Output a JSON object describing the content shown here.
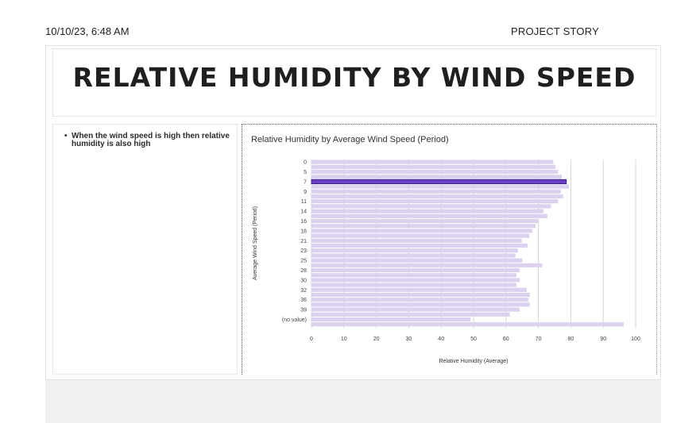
{
  "header": {
    "timestamp": "10/10/23, 6:48 AM",
    "doc_title": "PROJECT STORY"
  },
  "page_title": "RELATIVE HUMIDITY BY WIND SPEED",
  "note": {
    "bullet": "•",
    "text": "When the wind speed is high then relative humidity is also high"
  },
  "colors": {
    "bar": "#dcd2ef",
    "highlight": "#6a3fc4",
    "grid": "#d5d5d5"
  },
  "chart_data": {
    "type": "bar",
    "orientation": "horizontal",
    "title": "Relative Humidity by Average Wind Speed (Period)",
    "xlabel": "Relative Humidity (Average)",
    "ylabel": "Average Wind Speed (Period)",
    "xlim": [
      0,
      100
    ],
    "xticks": [
      0,
      10,
      20,
      30,
      40,
      50,
      60,
      70,
      80,
      90,
      100
    ],
    "categories": [
      "0",
      "",
      "5",
      "",
      "7",
      "",
      "9",
      "",
      "11",
      "",
      "14",
      "",
      "16",
      "",
      "18",
      "",
      "21",
      "",
      "23",
      "",
      "25",
      "",
      "28",
      "",
      "30",
      "",
      "32",
      "",
      "36",
      "",
      "39",
      "",
      "(no value)"
    ],
    "values": [
      74.6,
      75.3,
      76.1,
      77.2,
      78.6,
      79.4,
      76.9,
      77.6,
      76.1,
      73.9,
      71.6,
      72.8,
      69.9,
      69.1,
      68.1,
      67.2,
      64.9,
      66.7,
      63.7,
      62.9,
      65.0,
      71.2,
      64.2,
      63.2,
      64.2,
      63.2,
      66.4,
      67.4,
      66.9,
      67.4,
      64.2,
      61.2,
      49.1,
      96.3
    ],
    "highlight_index": 4,
    "grid": true,
    "legend": false
  }
}
